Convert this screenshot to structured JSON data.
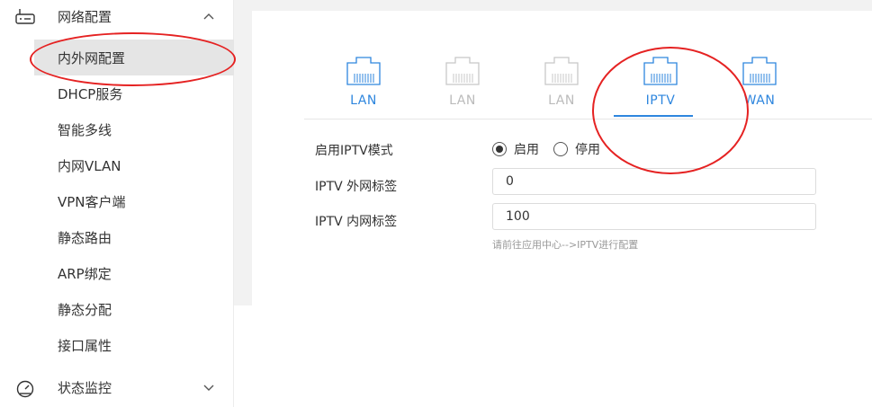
{
  "sidebar": {
    "groups": [
      {
        "label": "网络配置",
        "icon": "router-icon",
        "chevron": "chevron-up-icon"
      },
      {
        "label": "状态监控",
        "icon": "gauge-icon",
        "chevron": "chevron-down-icon"
      }
    ],
    "items": [
      {
        "label": "内外网配置",
        "active": true
      },
      {
        "label": "DHCP服务"
      },
      {
        "label": "智能多线"
      },
      {
        "label": "内网VLAN"
      },
      {
        "label": "VPN客户端"
      },
      {
        "label": "静态路由"
      },
      {
        "label": "ARP绑定"
      },
      {
        "label": "静态分配"
      },
      {
        "label": "接口属性"
      }
    ]
  },
  "tabs": [
    {
      "label": "LAN",
      "state": "enabled",
      "icon": "ethernet-port-icon"
    },
    {
      "label": "LAN",
      "state": "disabled",
      "icon": "ethernet-port-icon"
    },
    {
      "label": "LAN",
      "state": "disabled",
      "icon": "ethernet-port-icon"
    },
    {
      "label": "IPTV",
      "state": "selected",
      "icon": "ethernet-port-icon"
    },
    {
      "label": "WAN",
      "state": "enabled",
      "icon": "ethernet-port-icon"
    }
  ],
  "form": {
    "iptv_mode_label": "启用IPTV模式",
    "enable_label": "启用",
    "disable_label": "停用",
    "selected_option": "启用",
    "wan_tag_label": "IPTV 外网标签",
    "wan_tag_value": "0",
    "lan_tag_label": "IPTV 内网标签",
    "lan_tag_value": "100",
    "hint": "请前往应用中心-->IPTV进行配置"
  },
  "colors": {
    "accent": "#2e86de",
    "annotation": "#e52222",
    "disabled": "#bbbbbb"
  }
}
